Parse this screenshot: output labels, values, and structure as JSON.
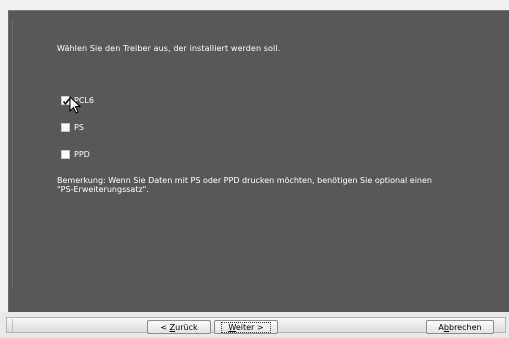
{
  "dialog": {
    "instruction": "Wählen Sie den Treiber aus, der installiert werden soll.",
    "options": [
      {
        "label": "PCL6",
        "checked": true
      },
      {
        "label": "PS",
        "checked": false
      },
      {
        "label": "PPD",
        "checked": false
      }
    ],
    "note_line1": "Bemerkung: Wenn Sie Daten mit PS oder PPD drucken möchten, benötigen Sie optional einen",
    "note_line2": "\"PS-Erweiterungssatz\"."
  },
  "footer": {
    "back": {
      "prefix": "< ",
      "mnemonic": "Z",
      "rest": "urück"
    },
    "next": {
      "mnemonic": "W",
      "rest": "eiter >"
    },
    "cancel": {
      "prefix": "A",
      "mnemonic": "b",
      "rest": "brechen"
    }
  },
  "colors": {
    "panel": "#585858",
    "text": "#ffffff",
    "footer": "#e9e9e9"
  }
}
